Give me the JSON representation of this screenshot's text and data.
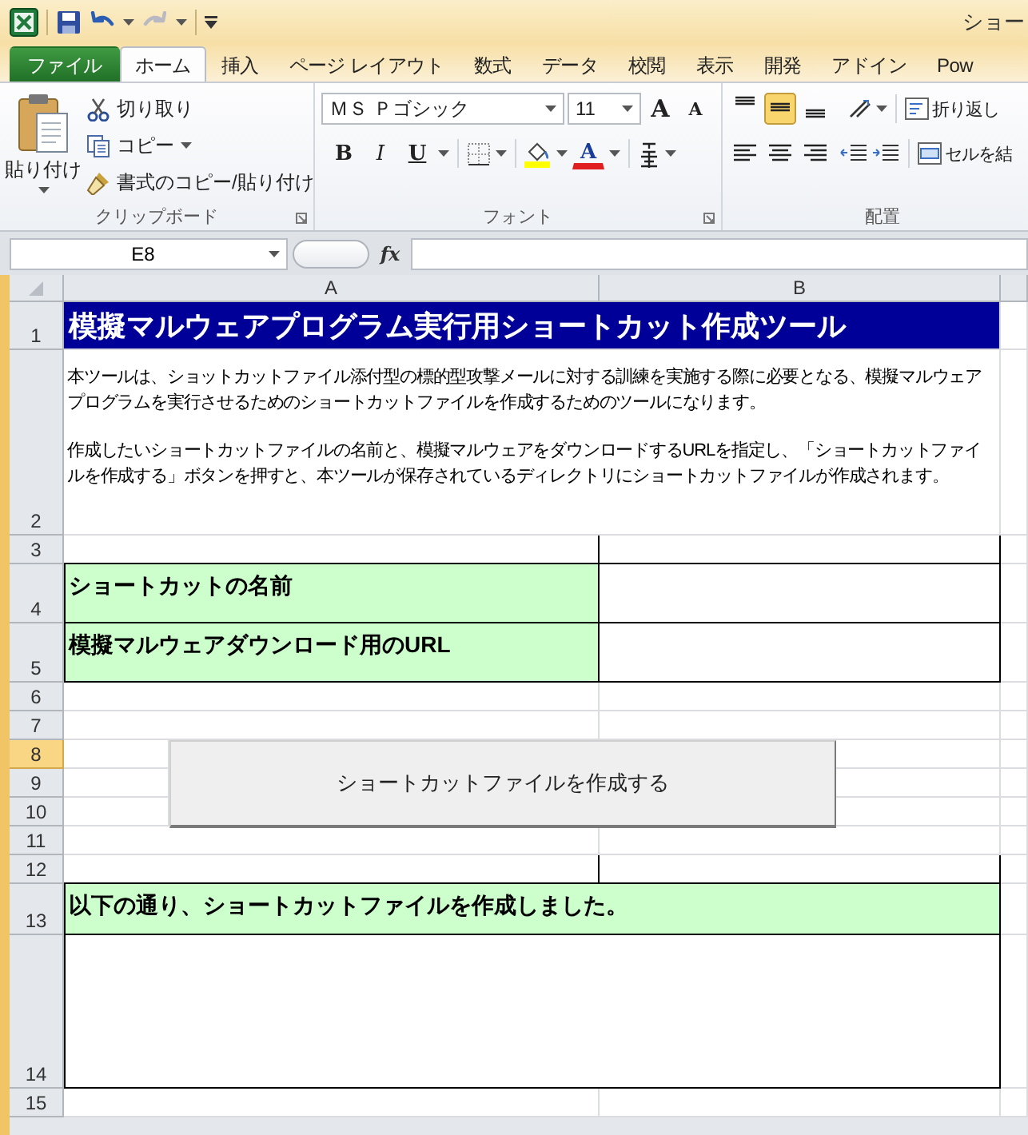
{
  "title_bar": {
    "title": "ショー"
  },
  "tabs": [
    {
      "label": "ファイル",
      "kind": "file",
      "selected": false
    },
    {
      "label": "ホーム",
      "kind": "tab",
      "selected": true
    },
    {
      "label": "挿入",
      "kind": "tab",
      "selected": false
    },
    {
      "label": "ページ レイアウト",
      "kind": "tab",
      "selected": false
    },
    {
      "label": "数式",
      "kind": "tab",
      "selected": false
    },
    {
      "label": "データ",
      "kind": "tab",
      "selected": false
    },
    {
      "label": "校閲",
      "kind": "tab",
      "selected": false
    },
    {
      "label": "表示",
      "kind": "tab",
      "selected": false
    },
    {
      "label": "開発",
      "kind": "tab",
      "selected": false
    },
    {
      "label": "アドイン",
      "kind": "tab",
      "selected": false
    },
    {
      "label": "Pow",
      "kind": "tab",
      "selected": false
    }
  ],
  "ribbon": {
    "clipboard": {
      "label": "クリップボード",
      "paste": "貼り付け",
      "commands": [
        "切り取り",
        "コピー",
        "書式のコピー/貼り付け"
      ]
    },
    "font": {
      "label": "フォント",
      "font_name": "ＭＳ Ｐゴシック",
      "font_size": "11",
      "grow": "A",
      "shrink": "A",
      "bold": "B",
      "italic": "I",
      "underline": "U",
      "font_color": "A"
    },
    "alignment": {
      "label": "配置",
      "vertical": [
        {
          "selected": false
        },
        {
          "selected": true
        },
        {
          "selected": false
        }
      ],
      "wrap_text": "折り返し",
      "merge": "セルを結"
    }
  },
  "formula_bar": {
    "name_box": "E8",
    "function_label": "fx"
  },
  "sheet": {
    "columns": [
      "A",
      "B"
    ],
    "rows": [
      {
        "number": "1",
        "kind": "title",
        "selected": false,
        "text": "模擬マルウェアプログラム実行用ショートカット作成ツール"
      },
      {
        "number": "2",
        "kind": "note",
        "selected": false,
        "paragraphs": [
          "本ツールは、ショットカットファイル添付型の標的型攻撃メールに対する訓練を実施する際に必要となる、模擬マルウェアプログラムを実行させるためのショートカットファイルを作成するためのツールになります。",
          "作成したいショートカットファイルの名前と、模擬マルウェアをダウンロードするURLを指定し、「ショートカットファイルを作成する」ボタンを押すと、本ツールが保存されているディレクトリにショートカットファイルが作成されます。"
        ]
      },
      {
        "number": "3",
        "kind": "blank",
        "selected": false
      },
      {
        "number": "4",
        "kind": "field",
        "selected": false,
        "label": "ショートカットの名前"
      },
      {
        "number": "5",
        "kind": "field",
        "selected": false,
        "label": "模擬マルウェアダウンロード用のURL"
      },
      {
        "number": "6",
        "kind": "blank",
        "selected": false
      },
      {
        "number": "7",
        "kind": "blank",
        "selected": false
      },
      {
        "number": "8",
        "kind": "blank",
        "selected": true
      },
      {
        "number": "9",
        "kind": "blank",
        "selected": false
      },
      {
        "number": "10",
        "kind": "blank",
        "selected": false
      },
      {
        "number": "11",
        "kind": "blank",
        "selected": false
      },
      {
        "number": "12",
        "kind": "blank",
        "selected": false
      },
      {
        "number": "13",
        "kind": "heading",
        "selected": false,
        "text": "以下の通り、ショートカットファイルを作成しました。"
      },
      {
        "number": "14",
        "kind": "output",
        "selected": false
      },
      {
        "number": "15",
        "kind": "blank",
        "selected": false
      }
    ],
    "button": "ショートカットファイルを作成する"
  }
}
